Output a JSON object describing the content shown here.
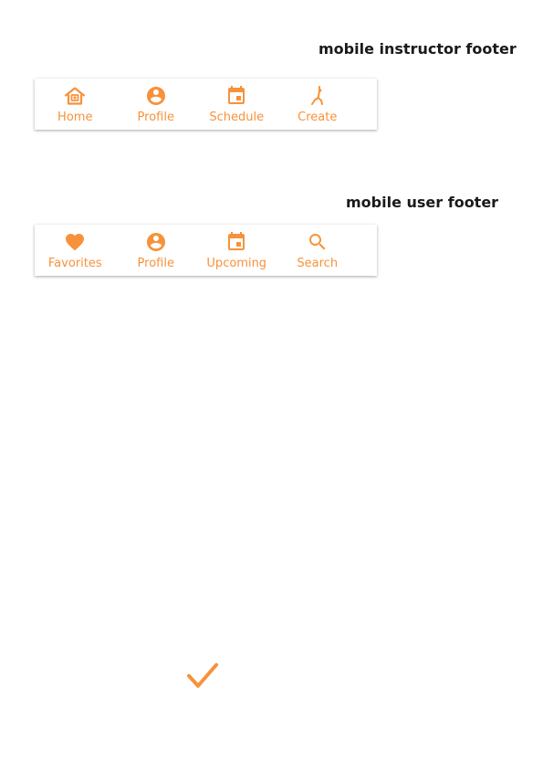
{
  "accent_color": "#f7923a",
  "instructor_section": {
    "title": "mobile instructor footer",
    "items": [
      {
        "label": "Home",
        "icon": "home-icon"
      },
      {
        "label": "Profile",
        "icon": "account-circle-icon"
      },
      {
        "label": "Schedule",
        "icon": "calendar-icon"
      },
      {
        "label": "Create",
        "icon": "yoga-pose-icon"
      }
    ]
  },
  "user_section": {
    "title": "mobile user footer",
    "items": [
      {
        "label": "Favorites",
        "icon": "heart-icon"
      },
      {
        "label": "Profile",
        "icon": "account-circle-icon"
      },
      {
        "label": "Upcoming",
        "icon": "calendar-icon"
      },
      {
        "label": "Search",
        "icon": "search-icon"
      }
    ]
  },
  "checkmark": {
    "icon": "checkmark-icon"
  }
}
